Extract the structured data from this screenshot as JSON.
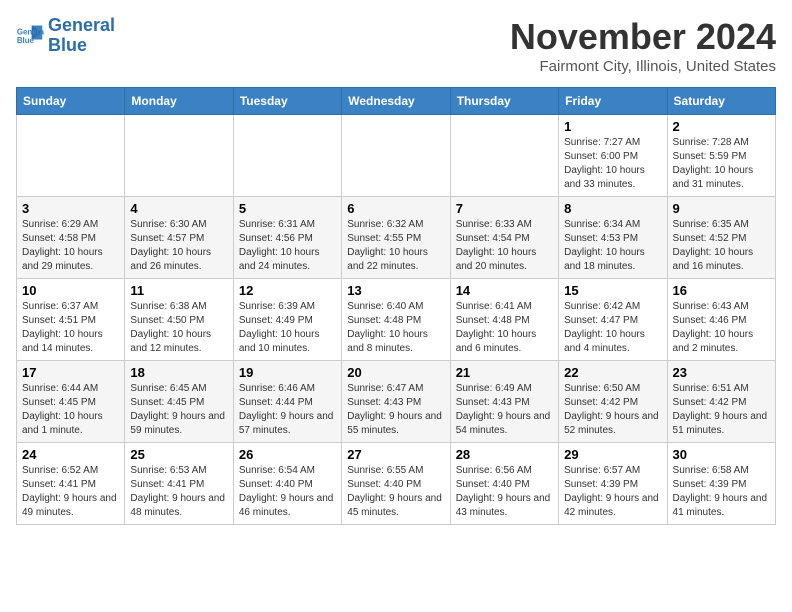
{
  "logo": {
    "line1": "General",
    "line2": "Blue"
  },
  "title": "November 2024",
  "subtitle": "Fairmont City, Illinois, United States",
  "days_header": [
    "Sunday",
    "Monday",
    "Tuesday",
    "Wednesday",
    "Thursday",
    "Friday",
    "Saturday"
  ],
  "weeks": [
    [
      {
        "day": "",
        "info": ""
      },
      {
        "day": "",
        "info": ""
      },
      {
        "day": "",
        "info": ""
      },
      {
        "day": "",
        "info": ""
      },
      {
        "day": "",
        "info": ""
      },
      {
        "day": "1",
        "info": "Sunrise: 7:27 AM\nSunset: 6:00 PM\nDaylight: 10 hours and 33 minutes."
      },
      {
        "day": "2",
        "info": "Sunrise: 7:28 AM\nSunset: 5:59 PM\nDaylight: 10 hours and 31 minutes."
      }
    ],
    [
      {
        "day": "3",
        "info": "Sunrise: 6:29 AM\nSunset: 4:58 PM\nDaylight: 10 hours and 29 minutes."
      },
      {
        "day": "4",
        "info": "Sunrise: 6:30 AM\nSunset: 4:57 PM\nDaylight: 10 hours and 26 minutes."
      },
      {
        "day": "5",
        "info": "Sunrise: 6:31 AM\nSunset: 4:56 PM\nDaylight: 10 hours and 24 minutes."
      },
      {
        "day": "6",
        "info": "Sunrise: 6:32 AM\nSunset: 4:55 PM\nDaylight: 10 hours and 22 minutes."
      },
      {
        "day": "7",
        "info": "Sunrise: 6:33 AM\nSunset: 4:54 PM\nDaylight: 10 hours and 20 minutes."
      },
      {
        "day": "8",
        "info": "Sunrise: 6:34 AM\nSunset: 4:53 PM\nDaylight: 10 hours and 18 minutes."
      },
      {
        "day": "9",
        "info": "Sunrise: 6:35 AM\nSunset: 4:52 PM\nDaylight: 10 hours and 16 minutes."
      }
    ],
    [
      {
        "day": "10",
        "info": "Sunrise: 6:37 AM\nSunset: 4:51 PM\nDaylight: 10 hours and 14 minutes."
      },
      {
        "day": "11",
        "info": "Sunrise: 6:38 AM\nSunset: 4:50 PM\nDaylight: 10 hours and 12 minutes."
      },
      {
        "day": "12",
        "info": "Sunrise: 6:39 AM\nSunset: 4:49 PM\nDaylight: 10 hours and 10 minutes."
      },
      {
        "day": "13",
        "info": "Sunrise: 6:40 AM\nSunset: 4:48 PM\nDaylight: 10 hours and 8 minutes."
      },
      {
        "day": "14",
        "info": "Sunrise: 6:41 AM\nSunset: 4:48 PM\nDaylight: 10 hours and 6 minutes."
      },
      {
        "day": "15",
        "info": "Sunrise: 6:42 AM\nSunset: 4:47 PM\nDaylight: 10 hours and 4 minutes."
      },
      {
        "day": "16",
        "info": "Sunrise: 6:43 AM\nSunset: 4:46 PM\nDaylight: 10 hours and 2 minutes."
      }
    ],
    [
      {
        "day": "17",
        "info": "Sunrise: 6:44 AM\nSunset: 4:45 PM\nDaylight: 10 hours and 1 minute."
      },
      {
        "day": "18",
        "info": "Sunrise: 6:45 AM\nSunset: 4:45 PM\nDaylight: 9 hours and 59 minutes."
      },
      {
        "day": "19",
        "info": "Sunrise: 6:46 AM\nSunset: 4:44 PM\nDaylight: 9 hours and 57 minutes."
      },
      {
        "day": "20",
        "info": "Sunrise: 6:47 AM\nSunset: 4:43 PM\nDaylight: 9 hours and 55 minutes."
      },
      {
        "day": "21",
        "info": "Sunrise: 6:49 AM\nSunset: 4:43 PM\nDaylight: 9 hours and 54 minutes."
      },
      {
        "day": "22",
        "info": "Sunrise: 6:50 AM\nSunset: 4:42 PM\nDaylight: 9 hours and 52 minutes."
      },
      {
        "day": "23",
        "info": "Sunrise: 6:51 AM\nSunset: 4:42 PM\nDaylight: 9 hours and 51 minutes."
      }
    ],
    [
      {
        "day": "24",
        "info": "Sunrise: 6:52 AM\nSunset: 4:41 PM\nDaylight: 9 hours and 49 minutes."
      },
      {
        "day": "25",
        "info": "Sunrise: 6:53 AM\nSunset: 4:41 PM\nDaylight: 9 hours and 48 minutes."
      },
      {
        "day": "26",
        "info": "Sunrise: 6:54 AM\nSunset: 4:40 PM\nDaylight: 9 hours and 46 minutes."
      },
      {
        "day": "27",
        "info": "Sunrise: 6:55 AM\nSunset: 4:40 PM\nDaylight: 9 hours and 45 minutes."
      },
      {
        "day": "28",
        "info": "Sunrise: 6:56 AM\nSunset: 4:40 PM\nDaylight: 9 hours and 43 minutes."
      },
      {
        "day": "29",
        "info": "Sunrise: 6:57 AM\nSunset: 4:39 PM\nDaylight: 9 hours and 42 minutes."
      },
      {
        "day": "30",
        "info": "Sunrise: 6:58 AM\nSunset: 4:39 PM\nDaylight: 9 hours and 41 minutes."
      }
    ]
  ]
}
